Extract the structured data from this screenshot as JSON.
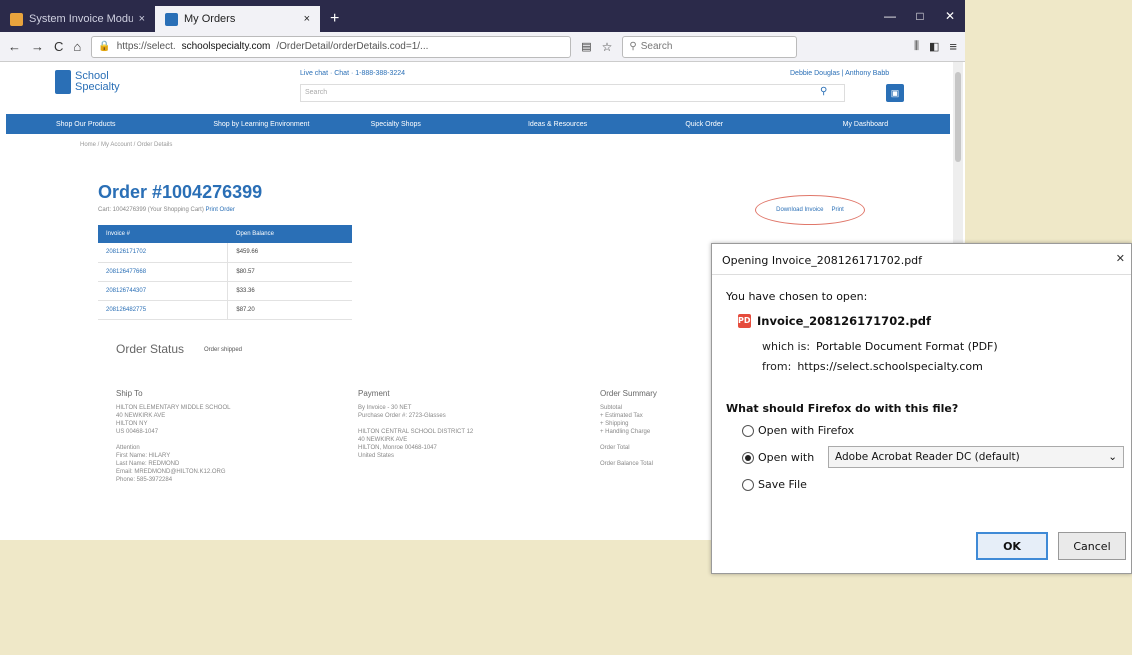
{
  "browser": {
    "tabs": [
      {
        "label": "System Invoice Module",
        "active": false
      },
      {
        "label": "My Orders",
        "active": true
      }
    ],
    "new_tab": "+",
    "nav": {
      "back": "←",
      "forward": "→",
      "reload": "C",
      "home": "⌂"
    },
    "url": {
      "prefix": "https://select.",
      "host": "schoolspecialty.com",
      "path": "/OrderDetail/orderDetails.cod=1/..."
    },
    "search_placeholder": "Search",
    "controls": {
      "min": "—",
      "max": "□",
      "close": "✕"
    }
  },
  "site": {
    "logo_text_1": "School",
    "logo_text_2": "Specialty",
    "contact": "Live chat · Chat · 1-888-388-3224",
    "account": "Debbie Douglas | Anthony Babb",
    "search_placeholder": "Search",
    "nav": [
      "Shop Our Products",
      "Shop by Learning Environment",
      "Specialty Shops",
      "Ideas & Resources",
      "Quick Order",
      "My Dashboard"
    ],
    "breadcrumb": "Home / My Account / Order Details"
  },
  "order": {
    "title": "Order #1004276399",
    "subtitle": "Cart: 1004276399 (Your Shopping Cart)",
    "subtitle_link": "Print Order",
    "download_link": "Download Invoice",
    "print_link": "Print",
    "invoice_headers": [
      "Invoice #",
      "Open Balance"
    ],
    "invoices": [
      {
        "number": "208126171702",
        "balance": "$459.66"
      },
      {
        "number": "208126477668",
        "balance": "$80.57"
      },
      {
        "number": "208126744307",
        "balance": "$33.36"
      },
      {
        "number": "208126482775",
        "balance": "$87.20"
      }
    ],
    "status_title": "Order Status",
    "status_value": "Order shipped",
    "ship_to": {
      "heading": "Ship To",
      "lines": [
        "HILTON ELEMENTARY MIDDLE SCHOOL",
        "40 NEWKIRK AVE",
        "HILTON NY",
        "US 00468-1047",
        "",
        "Attention",
        "First Name: HILARY",
        "Last Name: REDMOND",
        "Email: MREDMOND@HILTON.K12.ORG",
        "Phone: 585-3972284"
      ]
    },
    "payment": {
      "heading": "Payment",
      "lines": [
        "By Invoice - 30 NET",
        "Purchase Order #: 2723-Glasses",
        "",
        "HILTON CENTRAL SCHOOL DISTRICT 12",
        "40 NEWKIRK AVE",
        "HILTON, Monroe 00468-1047",
        "United States"
      ]
    },
    "summary": {
      "heading": "Order Summary",
      "lines": [
        "Subtotal",
        "+ Estimated Tax",
        "+ Shipping",
        "+ Handling Charge",
        "",
        "Order Total",
        "",
        "Order Balance Total"
      ]
    }
  },
  "dialog": {
    "title": "Opening Invoice_208126171702.pdf",
    "close": "✕",
    "chosen": "You have chosen to open:",
    "file_name": "Invoice_208126171702.pdf",
    "file_icon": "PDF",
    "which_is_label": "which is:",
    "which_is": "Portable Document Format (PDF)",
    "from_label": "from:",
    "from": "https://select.schoolspecialty.com",
    "question": "What should Firefox do with this file?",
    "options": [
      "Open with Firefox",
      "Open with",
      "Save File"
    ],
    "selected_option": 1,
    "app": "Adobe Acrobat Reader DC (default)",
    "ok": "OK",
    "cancel": "Cancel"
  }
}
